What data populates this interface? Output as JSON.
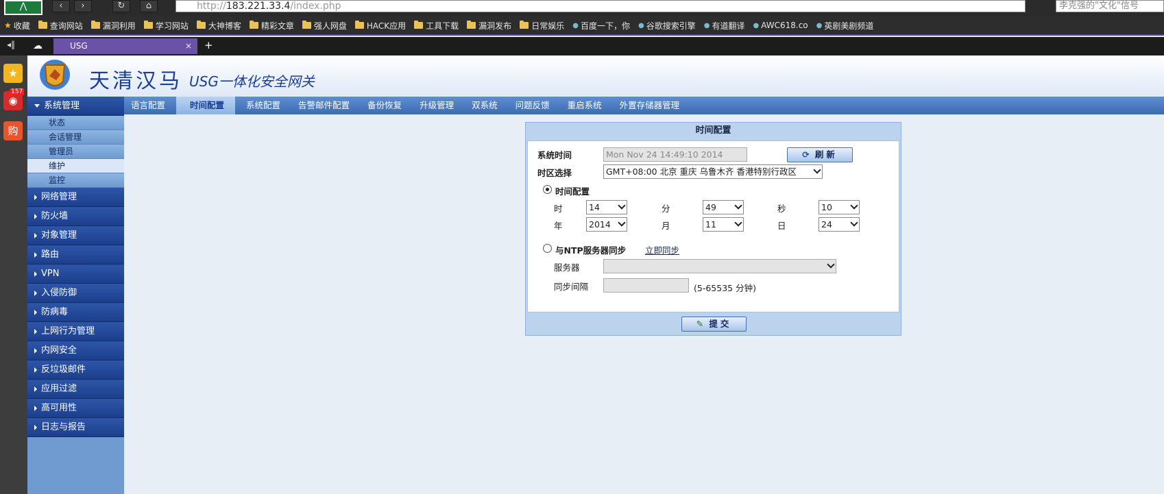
{
  "browser": {
    "url_host": "183.221.33.4",
    "url_prefix": "http://",
    "url_path": "/index.php",
    "search_text": "李克强的\"文化\"信号",
    "tab_title": "USG",
    "new_tab": "+",
    "bookmarks": [
      "收藏",
      "查询网站",
      "漏洞利用",
      "学习网站",
      "大神博客",
      "精彩文章",
      "强人网盘",
      "HACK应用",
      "工具下载",
      "漏洞发布",
      "日常娱乐",
      "百度一下，你",
      "谷歌搜索引擎",
      "有道翻译",
      "AWC618.co",
      "英剧美剧频道"
    ],
    "dock_badge": "157",
    "dock_buy": "购"
  },
  "app": {
    "brand": "天清汉马",
    "brand_sub": "USG一体化安全网关"
  },
  "sidebar": {
    "expanded": "系统管理",
    "sub_items": [
      "状态",
      "会话管理",
      "管理员",
      "维护",
      "监控"
    ],
    "active_sub": 3,
    "groups": [
      "网络管理",
      "防火墙",
      "对象管理",
      "路由",
      "VPN",
      "入侵防御",
      "防病毒",
      "上网行为管理",
      "内网安全",
      "反垃圾邮件",
      "应用过滤",
      "高可用性",
      "日志与报告"
    ]
  },
  "top_tabs": [
    "语言配置",
    "时间配置",
    "系统配置",
    "告警邮件配置",
    "备份恢复",
    "升级管理",
    "双系统",
    "问题反馈",
    "重启系统",
    "外置存储器管理"
  ],
  "active_tab": 1,
  "panel": {
    "title": "时间配置",
    "system_time_label": "系统时间",
    "system_time_value": "Mon Nov 24 14:49:10 2014",
    "refresh_button": "刷新",
    "timezone_label": "时区选择",
    "timezone_value": "GMT+08:00 北京 重庆 乌鲁木齐 香港特别行政区",
    "manual_radio_label": "时间配置",
    "hour_label": "时",
    "hour_value": "14",
    "minute_label": "分",
    "minute_value": "49",
    "second_label": "秒",
    "second_value": "10",
    "year_label": "年",
    "year_value": "2014",
    "month_label": "月",
    "month_value": "11",
    "day_label": "日",
    "day_value": "24",
    "ntp_radio_label": "与NTP服务器同步",
    "sync_now_link": "立即同步",
    "server_label": "服务器",
    "server_value": "",
    "interval_label": "同步间隔",
    "interval_value": "",
    "interval_hint": "(5-65535 分钟)",
    "submit_button": "提交"
  },
  "colors": {
    "accent": "#1a3d9a",
    "menu_bg": "#6f9bd1",
    "tab_bar": "#4a7bc2",
    "panel_header": "#bcd3ee"
  }
}
